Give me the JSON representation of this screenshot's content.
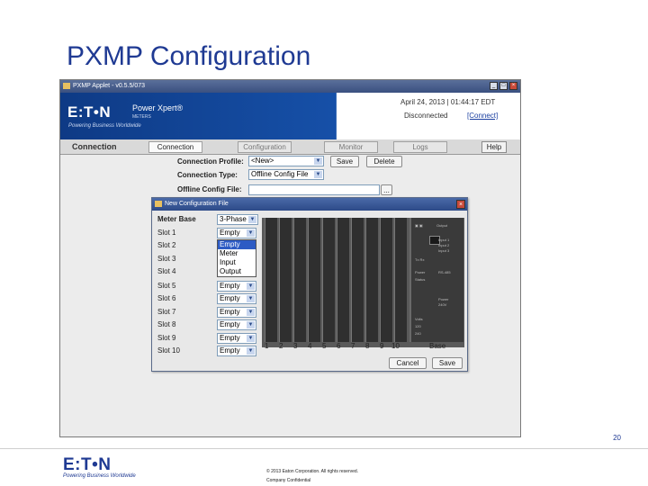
{
  "slide": {
    "title": "PXMP Configuration",
    "page_number": "20",
    "footer_logo": "E:T•N",
    "footer_tagline": "Powering Business Worldwide",
    "copyright": "© 2013 Eaton Corporation. All rights reserved.",
    "confidential": "Company Confidential"
  },
  "app": {
    "window_title": "PXMP Applet - v0.5.5/073",
    "brand_logo": "E:T•N",
    "brand_tagline": "Powering Business Worldwide",
    "product_name": "Power Xpert®",
    "product_sub": "METERS",
    "datetime": "April 24, 2013 | 01:44:17 EDT",
    "status": "Disconnected",
    "connect_label": "[Connect]",
    "section_label": "Connection",
    "tabs": [
      {
        "label": "Connection",
        "active": true
      },
      {
        "label": "Configuration",
        "active": false
      },
      {
        "label": "Monitor",
        "active": false
      },
      {
        "label": "Logs",
        "active": false
      }
    ],
    "help_label": "Help",
    "connection_profile_label": "Connection Profile:",
    "connection_profile_value": "<New>",
    "save_label": "Save",
    "delete_label": "Delete",
    "connection_type_label": "Connection Type:",
    "connection_type_value": "Offline Config File",
    "offline_config_label": "Offline Config File:",
    "offline_config_value": "",
    "browse_label": "..."
  },
  "dialog": {
    "title": "New Configuration File",
    "meter_base_label": "Meter Base",
    "meter_base_value": "3-Phase",
    "slots": [
      {
        "label": "Slot 1",
        "value": "Empty"
      },
      {
        "label": "Slot 2",
        "value": "Empty"
      },
      {
        "label": "Slot 3",
        "value": "Empty"
      },
      {
        "label": "Slot 4",
        "value": "Empty"
      },
      {
        "label": "Slot 5",
        "value": "Empty"
      },
      {
        "label": "Slot 6",
        "value": "Empty"
      },
      {
        "label": "Slot 7",
        "value": "Empty"
      },
      {
        "label": "Slot 8",
        "value": "Empty"
      },
      {
        "label": "Slot 9",
        "value": "Empty"
      },
      {
        "label": "Slot 10",
        "value": "Empty"
      }
    ],
    "dropdown_options": [
      "Empty",
      "Meter",
      "Input",
      "Output"
    ],
    "dropdown_selected": "Empty",
    "rack_numbers": [
      "1",
      "2",
      "3",
      "4",
      "5",
      "6",
      "7",
      "8",
      "9",
      "10"
    ],
    "base_label": "Base",
    "cancel_label": "Cancel",
    "save_label": "Save"
  }
}
